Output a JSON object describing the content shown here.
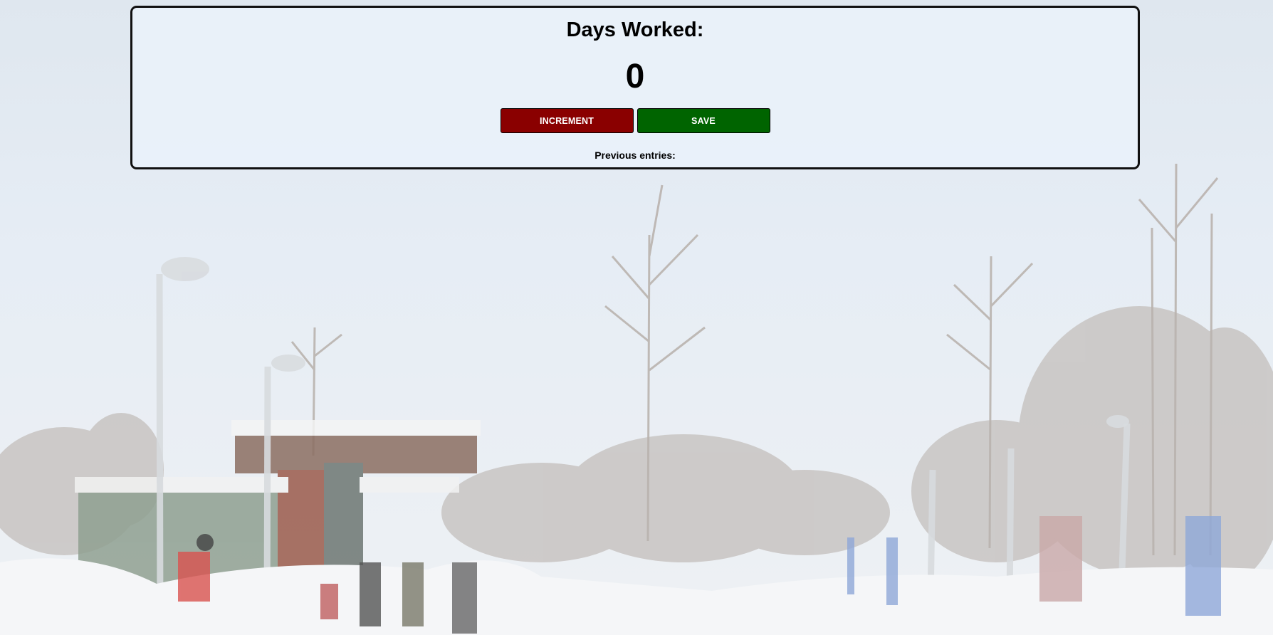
{
  "panel": {
    "title": "Days Worked:",
    "count": "0",
    "increment_label": "INCREMENT",
    "save_label": "SAVE",
    "previous_entries_label": "Previous entries:"
  },
  "colors": {
    "increment_button": "#8a0000",
    "save_button": "#006400",
    "panel_border": "#111111",
    "panel_background": "#e9f1fa"
  },
  "background": {
    "description_icon": "snowy-train-station-photo"
  }
}
